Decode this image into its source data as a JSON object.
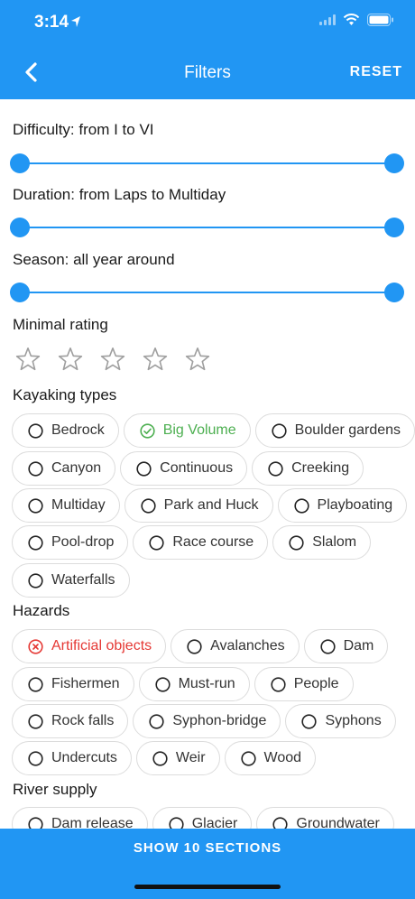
{
  "status_bar": {
    "time": "3:14"
  },
  "header": {
    "title": "Filters",
    "reset_label": "RESET"
  },
  "filters": {
    "difficulty": {
      "label": "Difficulty: from I to VI"
    },
    "duration": {
      "label": "Duration: from Laps to Multiday"
    },
    "season": {
      "label": "Season: all year around"
    },
    "rating": {
      "label": "Minimal rating",
      "value": 0,
      "max": 5
    }
  },
  "kayaking_types": {
    "title": "Kayaking types",
    "chips": [
      {
        "label": "Bedrock",
        "state": "off"
      },
      {
        "label": "Big Volume",
        "state": "selected"
      },
      {
        "label": "Boulder gardens",
        "state": "off"
      },
      {
        "label": "Canyon",
        "state": "off"
      },
      {
        "label": "Continuous",
        "state": "off"
      },
      {
        "label": "Creeking",
        "state": "off"
      },
      {
        "label": "Multiday",
        "state": "off"
      },
      {
        "label": "Park and Huck",
        "state": "off"
      },
      {
        "label": "Playboating",
        "state": "off"
      },
      {
        "label": "Pool-drop",
        "state": "off"
      },
      {
        "label": "Race course",
        "state": "off"
      },
      {
        "label": "Slalom",
        "state": "off"
      },
      {
        "label": "Waterfalls",
        "state": "off"
      }
    ]
  },
  "hazards": {
    "title": "Hazards",
    "chips": [
      {
        "label": "Artificial objects",
        "state": "excluded"
      },
      {
        "label": "Avalanches",
        "state": "off"
      },
      {
        "label": "Dam",
        "state": "off"
      },
      {
        "label": "Fishermen",
        "state": "off"
      },
      {
        "label": "Must-run",
        "state": "off"
      },
      {
        "label": "People",
        "state": "off"
      },
      {
        "label": "Rock falls",
        "state": "off"
      },
      {
        "label": "Syphon-bridge",
        "state": "off"
      },
      {
        "label": "Syphons",
        "state": "off"
      },
      {
        "label": "Undercuts",
        "state": "off"
      },
      {
        "label": "Weir",
        "state": "off"
      },
      {
        "label": "Wood",
        "state": "off"
      }
    ]
  },
  "river_supply": {
    "title": "River supply",
    "chips": [
      {
        "label": "Dam release",
        "state": "off"
      },
      {
        "label": "Glacier",
        "state": "off"
      },
      {
        "label": "Groundwater",
        "state": "off"
      }
    ]
  },
  "footer": {
    "show_label": "SHOW 10 SECTIONS"
  },
  "colors": {
    "primary": "#2196f3",
    "selected": "#4caf50",
    "excluded": "#e53935"
  }
}
